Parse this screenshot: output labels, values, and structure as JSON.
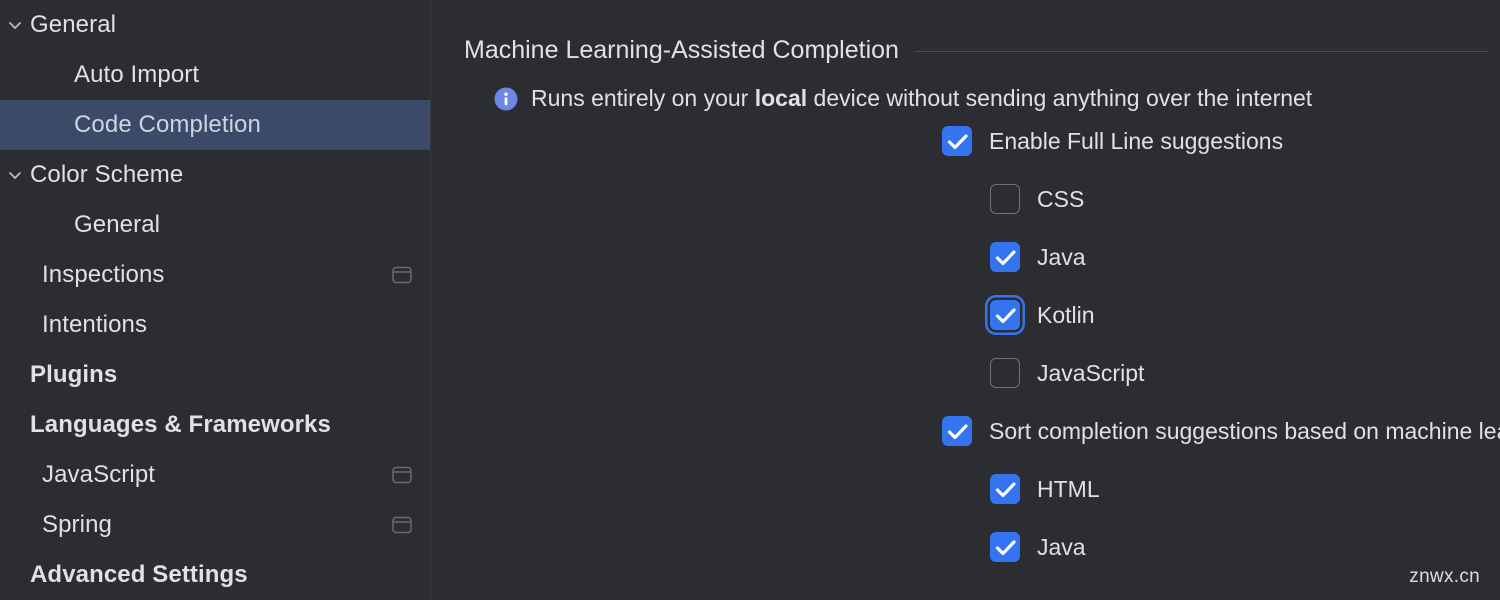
{
  "sidebar": {
    "items": [
      {
        "label": "General",
        "indent": 0,
        "chevron": "chevron-down",
        "bold": false,
        "selected": false,
        "scope_icon": false
      },
      {
        "label": "Auto Import",
        "indent": 2,
        "chevron": "",
        "bold": false,
        "selected": false,
        "scope_icon": false
      },
      {
        "label": "Code Completion",
        "indent": 2,
        "chevron": "",
        "bold": false,
        "selected": true,
        "scope_icon": false
      },
      {
        "label": "Color Scheme",
        "indent": 0,
        "chevron": "chevron-down",
        "bold": false,
        "selected": false,
        "scope_icon": false
      },
      {
        "label": "General",
        "indent": 2,
        "chevron": "",
        "bold": false,
        "selected": false,
        "scope_icon": false
      },
      {
        "label": "Inspections",
        "indent": 1,
        "chevron": "",
        "bold": false,
        "selected": false,
        "scope_icon": true
      },
      {
        "label": "Intentions",
        "indent": 1,
        "chevron": "",
        "bold": false,
        "selected": false,
        "scope_icon": false
      },
      {
        "label": "Plugins",
        "indent": 0,
        "chevron": "",
        "bold": true,
        "selected": false,
        "scope_icon": false
      },
      {
        "label": "Languages & Frameworks",
        "indent": 0,
        "chevron": "",
        "bold": true,
        "selected": false,
        "scope_icon": false
      },
      {
        "label": "JavaScript",
        "indent": 1,
        "chevron": "",
        "bold": false,
        "selected": false,
        "scope_icon": true
      },
      {
        "label": "Spring",
        "indent": 1,
        "chevron": "",
        "bold": false,
        "selected": false,
        "scope_icon": true
      },
      {
        "label": "Advanced Settings",
        "indent": 0,
        "chevron": "",
        "bold": true,
        "selected": false,
        "scope_icon": false
      }
    ]
  },
  "main": {
    "section_title": "Machine Learning-Assisted Completion",
    "notice": {
      "icon": "info-icon",
      "text_before": "Runs entirely on your ",
      "text_bold": "local",
      "text_after": " device without sending anything over the internet"
    },
    "options": [
      {
        "label": "Enable Full Line suggestions",
        "checked": true,
        "level": 0,
        "focused": false,
        "help": false
      },
      {
        "label": "CSS",
        "checked": false,
        "level": 1,
        "focused": false,
        "help": false
      },
      {
        "label": "Java",
        "checked": true,
        "level": 1,
        "focused": false,
        "help": false
      },
      {
        "label": "Kotlin",
        "checked": true,
        "level": 1,
        "focused": true,
        "help": false
      },
      {
        "label": "JavaScript",
        "checked": false,
        "level": 1,
        "focused": false,
        "help": false
      },
      {
        "label": "Sort completion suggestions based on machine learning",
        "checked": true,
        "level": 0,
        "focused": false,
        "help": true
      },
      {
        "label": "HTML",
        "checked": true,
        "level": 1,
        "focused": false,
        "help": false
      },
      {
        "label": "Java",
        "checked": true,
        "level": 1,
        "focused": false,
        "help": false
      }
    ]
  },
  "watermark": {
    "text": "znwx.cn"
  },
  "colors": {
    "background": "#2b2d30",
    "selection": "#3a4a68",
    "accent": "#3574f0",
    "text": "#dfe1e5",
    "divider": "#393b40"
  }
}
